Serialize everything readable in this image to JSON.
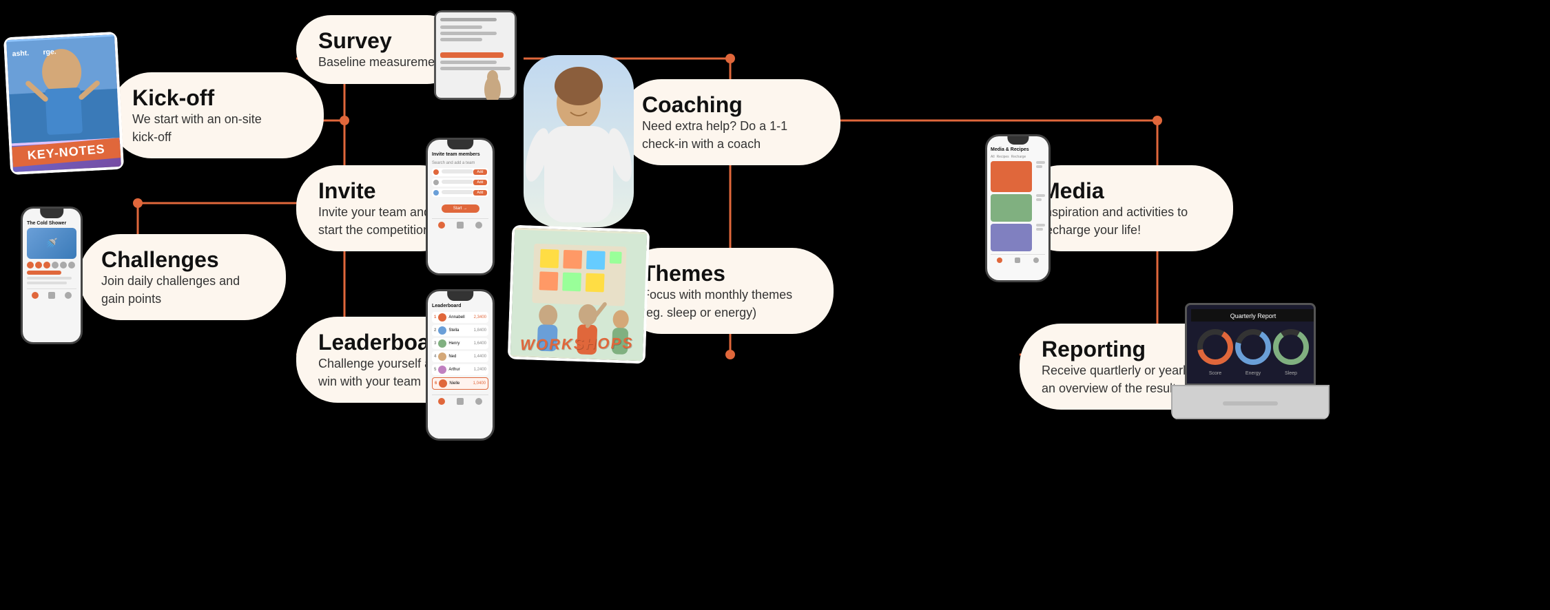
{
  "background": "#000000",
  "accent_color": "#e0673b",
  "cards": {
    "kickoff": {
      "title": "Kick-off",
      "subtitle": "We start with an on-site kick-off"
    },
    "survey": {
      "title": "Survey",
      "subtitle": "Baseline measurement"
    },
    "invite": {
      "title": "Invite",
      "subtitle": "Invite your team and start the competition"
    },
    "leaderboard": {
      "title": "Leaderboard",
      "subtitle": "Challenge yourself and win with your team"
    },
    "challenges": {
      "title": "Challenges",
      "subtitle": "Join daily challenges and gain points"
    },
    "coaching": {
      "title": "Coaching",
      "subtitle": "Need extra help? Do a 1-1 check-in with a coach"
    },
    "themes": {
      "title": "Themes",
      "subtitle": "Focus with monthly themes (eg. sleep or energy)"
    },
    "media": {
      "title": "Media",
      "subtitle": "Inspiration and activities to recharge your life!"
    },
    "reporting": {
      "title": "Reporting",
      "subtitle": "Receive quartlerly or yearly an overview of the results"
    }
  },
  "images": {
    "keynotes_label": "KEY-NOTES",
    "workshops_label": "WORKSHOPS"
  },
  "phone_invite_title": "Invite team members",
  "phone_leaderboard_title": "Leaderboard",
  "phone_challenges_title": "The Cold Shower"
}
